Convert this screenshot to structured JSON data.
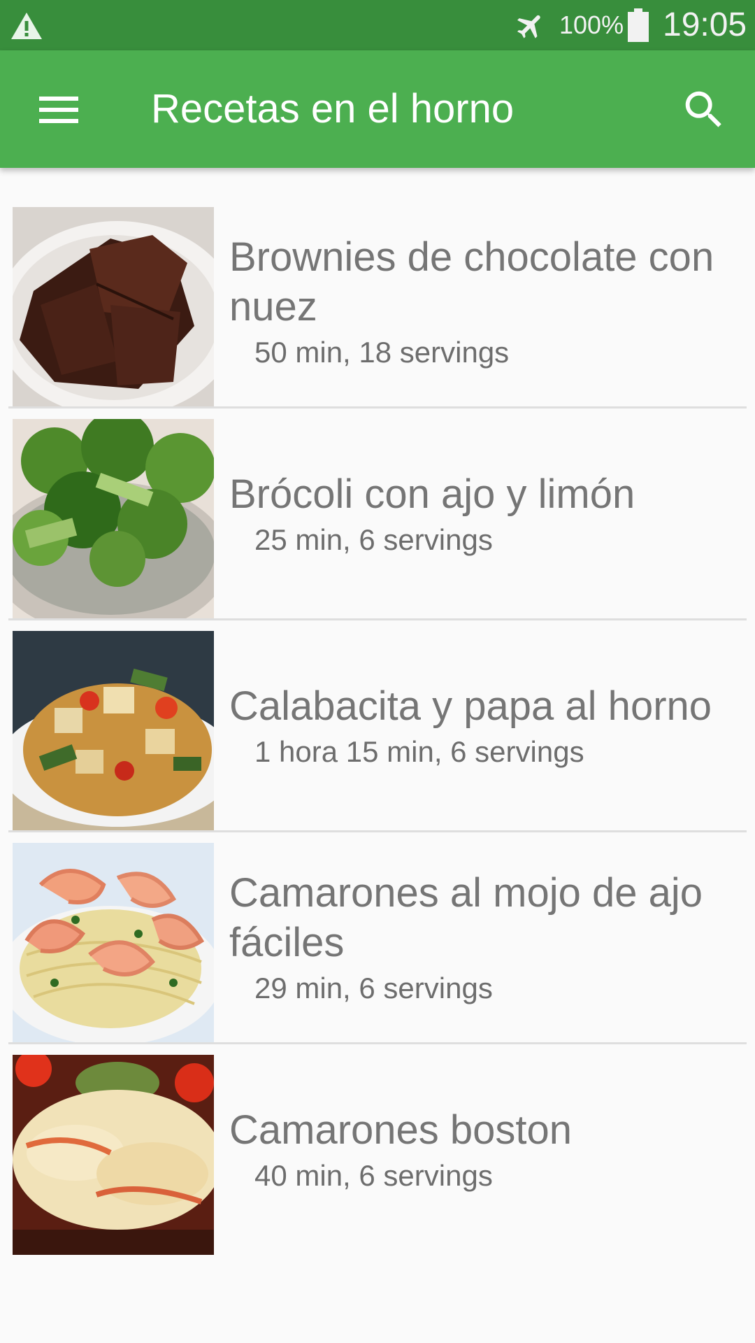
{
  "status_bar": {
    "battery": "100%",
    "time": "19:05",
    "icons": [
      "warning-icon",
      "airplane-mode-icon",
      "battery-icon"
    ]
  },
  "app_bar": {
    "title": "Recetas en el horno",
    "color": "#4caf50",
    "status_color": "#388e3c",
    "icons": [
      "menu-icon",
      "search-icon"
    ]
  },
  "recipes": [
    {
      "title": "Brownies de chocolate con nuez",
      "meta": "50 min, 18 servings",
      "image": "brownies-thumbnail"
    },
    {
      "title": "Brócoli con ajo y limón",
      "meta": "25 min, 6 servings",
      "image": "broccoli-thumbnail"
    },
    {
      "title": "Calabacita y papa al horno",
      "meta": "1 hora 15 min, 6 servings",
      "image": "zucchini-potato-thumbnail"
    },
    {
      "title": "Camarones al mojo de ajo fáciles",
      "meta": "29 min, 6 servings",
      "image": "garlic-shrimp-pasta-thumbnail"
    },
    {
      "title": "Camarones boston",
      "meta": "40 min, 6 servings",
      "image": "boston-shrimp-thumbnail"
    }
  ]
}
